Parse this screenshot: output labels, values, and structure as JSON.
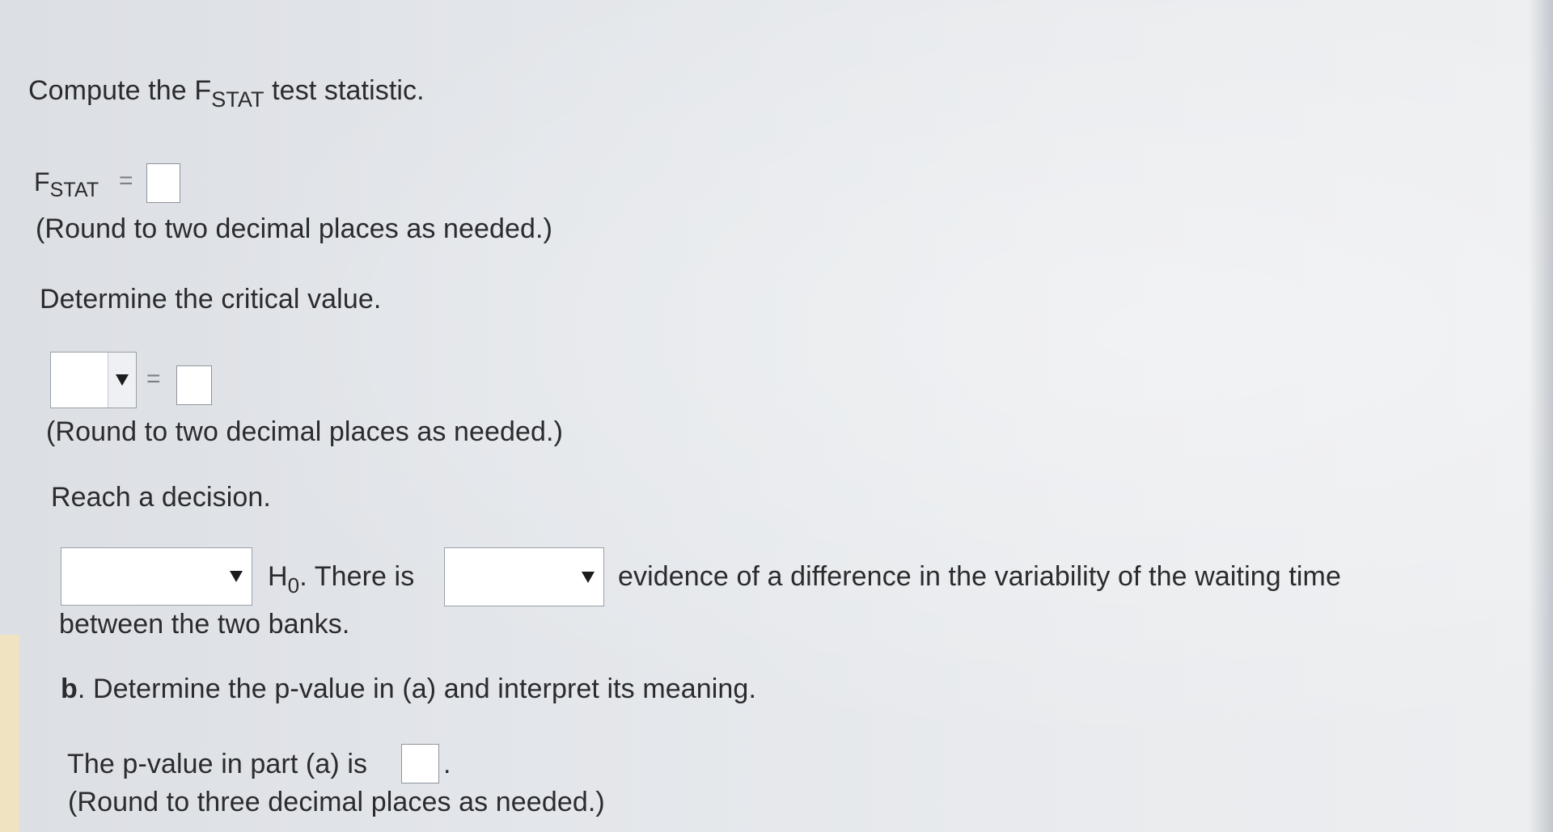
{
  "part_a": {
    "compute_prefix": "Compute the F",
    "compute_subscript": "STAT",
    "compute_suffix": "test statistic.",
    "fstat_label": "F",
    "fstat_subscript": "STAT",
    "equals": "=",
    "round_two_1": "(Round to two decimal places as needed.)",
    "critical_heading": "Determine the critical value.",
    "critical_select_value": "",
    "round_two_2": "(Round to two decimal places as needed.)",
    "decision_heading": "Reach a decision.",
    "decision_select_value": "",
    "h0_letter": "H",
    "h0_subscript": "0",
    "there_is": ". There is",
    "evidence_select_value": "",
    "evidence_text": "evidence of a difference in the variability of the waiting time",
    "between_text": "between the two banks."
  },
  "part_b": {
    "label": "b",
    "heading": ". Determine the p-value in (a) and interpret its meaning.",
    "pvalue_prefix": "The p-value in part (a) is",
    "pvalue_suffix": ".",
    "round_three": "(Round to three decimal places as needed.)"
  },
  "icons": {
    "dropdown": "triangle-down-icon"
  }
}
